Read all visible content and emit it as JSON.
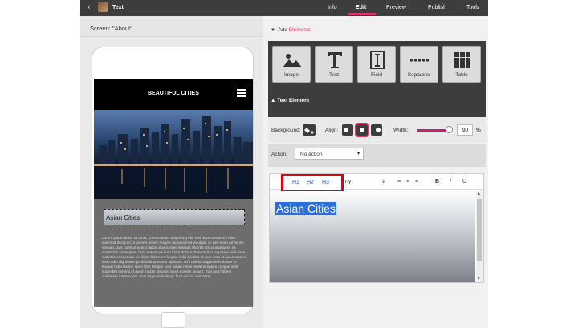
{
  "topbar": {
    "back_icon": "chevron-left-icon",
    "title": "Text",
    "tabs": [
      {
        "label": "Info",
        "active": false
      },
      {
        "label": "Edit",
        "active": true
      },
      {
        "label": "Preview",
        "active": false
      },
      {
        "label": "Publish",
        "active": false
      },
      {
        "label": "Tools",
        "active": false
      }
    ],
    "accent_color": "#e2336f"
  },
  "left": {
    "screen_label": "Screen: \"About\"",
    "phone": {
      "header_title": "BEAUTIFUL CITIES",
      "menu_icon": "hamburger-icon",
      "heading": "Asian Cities",
      "body_text": "Lorem ipsum dolor sit amet, consectetuer adipiscing elit, sed diam nonummy nibh euismod tincidunt ut laoreet dolore magna aliquam erat volutpat. Ut wisi enim ad minim veniam, quis nostrud exerci tation ullamcorper suscipit lobortis nisl ut aliquip ex ea commodo consequat. Duis autem vel eum iriure dolor in hendrerit in vulputate velit esse molestie consequat, vel illum dolore eu feugiat nulla facilisis at vero eros et accumsan et iusto odio dignissim qui blandit praesent luptatum zzril delenit augue duis dolore te feugait nulla facilisi. Nam liber tempor cum soluta nobis eleifend option congue nihil imperdiet doming id quod mazim placerat facer possim assum. Typi non habent claritatem insitam; est usus legentis in iis qui facit eorum claritatem."
    }
  },
  "right": {
    "add_elements_prefix": "Add",
    "add_elements_link": "Elements",
    "elements": [
      {
        "label": "Image",
        "icon": "image-icon"
      },
      {
        "label": "Text",
        "icon": "text-icon"
      },
      {
        "label": "Field",
        "icon": "field-icon"
      },
      {
        "label": "Separator",
        "icon": "separator-icon"
      },
      {
        "label": "Table",
        "icon": "table-icon"
      }
    ],
    "text_element_label": "Text Element",
    "background_label": "Background:",
    "align_label": "Align:",
    "width_label": "Width:",
    "width_value": "90",
    "width_unit": "%",
    "action_label": "Action:",
    "action_value": "No action",
    "toolbar": {
      "h1": "H1",
      "h2": "H2",
      "h3": "H3",
      "font_fragment": "ny",
      "bold": "B",
      "italic": "I",
      "underline": "U"
    },
    "editor_text": "Asian Cities"
  }
}
